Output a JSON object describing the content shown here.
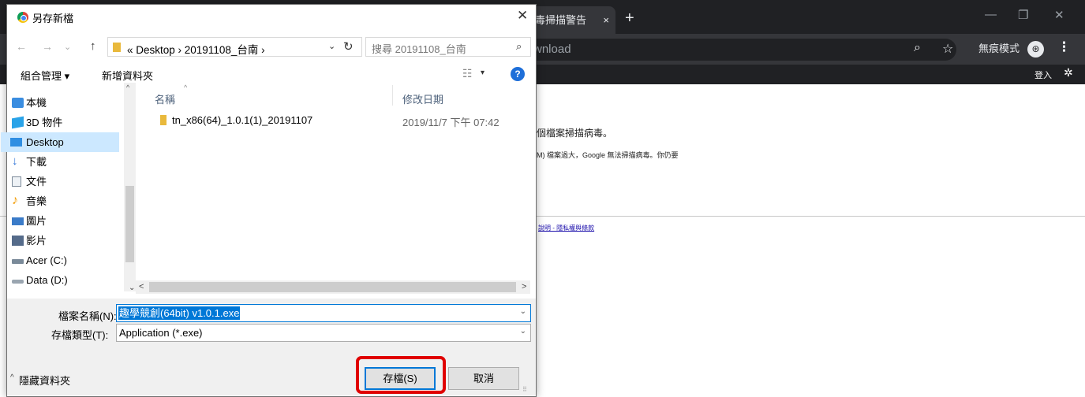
{
  "browser": {
    "tab_title": "毒掃描警告",
    "tab_close": "×",
    "new_tab": "+",
    "win_min": "—",
    "win_max": "❐",
    "win_close": "✕",
    "omnibox_text": "wnload",
    "zoom_icon": "⌕",
    "star_icon": "☆",
    "incognito_label": "無痕模式",
    "incognito_avatar": "⊛",
    "menu_icon": "⋮",
    "signin_label": "登入",
    "settings_icon": "✲",
    "page_line1": "個檔案掃描病毒。",
    "page_line2": "M) 檔案過大，Google 無法掃描病毒。你仍要",
    "footer_links": "說明 - 隱私權與條款"
  },
  "dialog": {
    "title": "另存新檔",
    "close_icon": "✕",
    "nav_back": "←",
    "nav_forward": "→",
    "nav_recent": "⌄",
    "nav_up": "↑",
    "breadcrumb": "« Desktop › 20191108_台南 ›",
    "address_dropdown": "⌄",
    "refresh_icon": "↻",
    "search_placeholder": "搜尋 20191108_台南",
    "search_icon": "⌕",
    "organize_label": "組合管理 ▾",
    "new_folder_label": "新增資料夾",
    "view_icon": "☷",
    "view_dropdown": "▾",
    "help_icon": "?",
    "nav_items": [
      {
        "label": "本機",
        "icon": "pc-icon",
        "color": "#3a8de0"
      },
      {
        "label": "3D 物件",
        "icon": "cube-icon",
        "color": "#2aa3e8"
      },
      {
        "label": "Desktop",
        "icon": "desktop-icon",
        "color": "#2f8ee2"
      },
      {
        "label": "下載",
        "icon": "download-icon",
        "color": "#2f74d8"
      },
      {
        "label": "文件",
        "icon": "document-icon",
        "color": "#7c8a99"
      },
      {
        "label": "音樂",
        "icon": "music-icon",
        "color": "#f29a00"
      },
      {
        "label": "圖片",
        "icon": "picture-icon",
        "color": "#3a7bc8"
      },
      {
        "label": "影片",
        "icon": "video-icon",
        "color": "#556b8a"
      },
      {
        "label": "Acer (C:)",
        "icon": "drive-c-icon",
        "color": "#7a8a99"
      },
      {
        "label": "Data (D:)",
        "icon": "drive-d-icon",
        "color": "#9aa5b0"
      }
    ],
    "selected_nav": "Desktop",
    "columns": {
      "sort_indicator": "^",
      "name": "名稱",
      "date": "修改日期"
    },
    "files": [
      {
        "name": "tn_x86(64)_1.0.1(1)_20191107",
        "date": "2019/11/7 下午 07:42"
      }
    ],
    "scroll_left": "<",
    "scroll_right": ">",
    "scroll_up": "^",
    "scroll_down": "⌄",
    "nav_collapse": "⌄",
    "filename_label": "檔案名稱(N):",
    "filename_value": "趣學競創(64bit) v1.0.1.exe",
    "filetype_label": "存檔類型(T):",
    "filetype_value": "Application (*.exe)",
    "dropdown_glyph": "⌄",
    "hide_folders_label": "隱藏資料夾",
    "hide_folders_chevron": "^",
    "save_button": "存檔(S)",
    "cancel_button": "取消",
    "resize_grip": "⠿"
  },
  "colors": {
    "accent": "#0078d7",
    "highlight": "#e00000",
    "selection": "#cce8ff"
  }
}
